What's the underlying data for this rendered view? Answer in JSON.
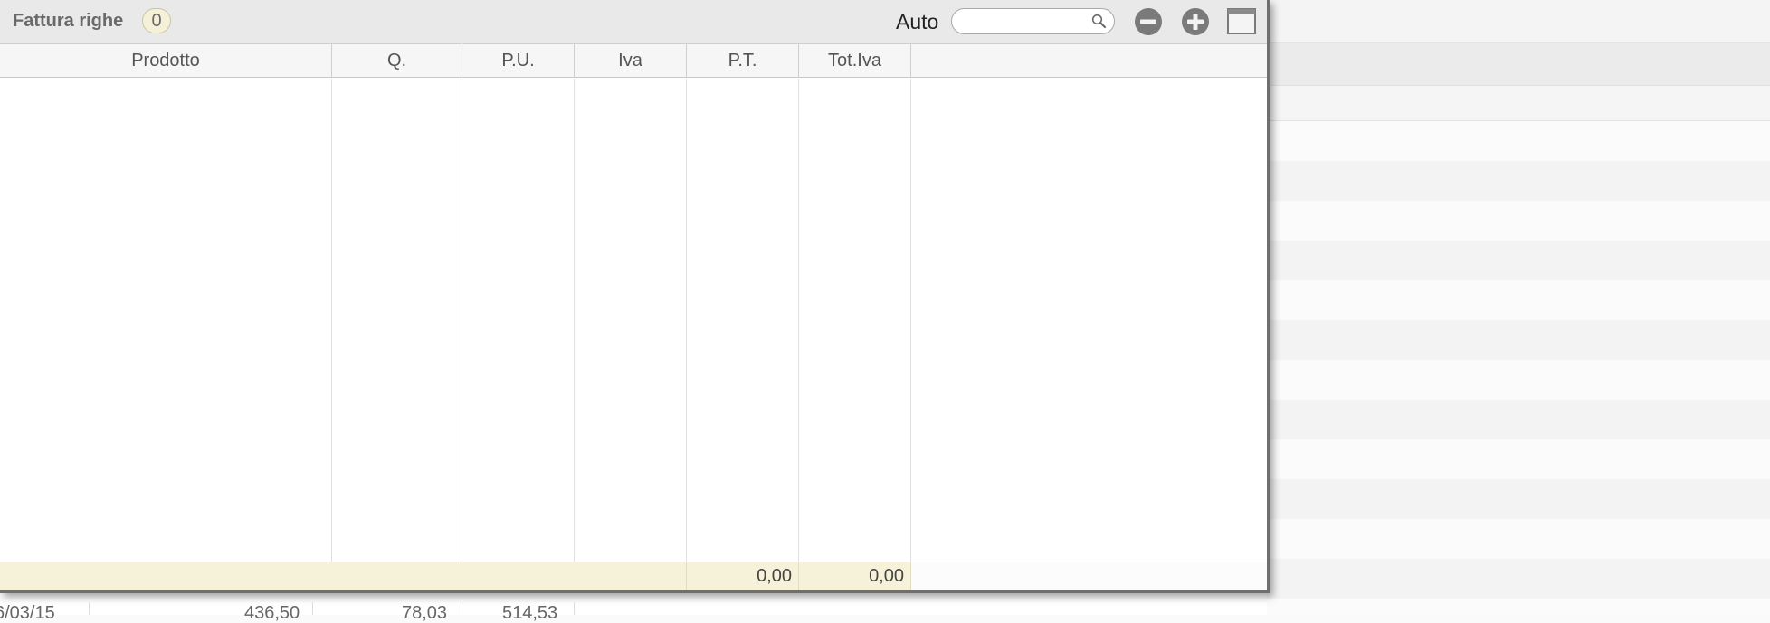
{
  "panel": {
    "title": "Fattura righe",
    "count": "0",
    "search_label": "Auto",
    "search_value": "",
    "icons": {
      "search": "magnifier-icon",
      "remove": "minus-circle-icon",
      "add": "plus-circle-icon",
      "window": "window-icon"
    }
  },
  "table": {
    "columns": [
      {
        "label": "Prodotto"
      },
      {
        "label": "Q."
      },
      {
        "label": "P.U."
      },
      {
        "label": "Iva"
      },
      {
        "label": "P.T."
      },
      {
        "label": "Tot.Iva"
      }
    ],
    "rows": [],
    "footer": {
      "pt_total": "0,00",
      "iva_total": "0,00"
    }
  },
  "background_row": {
    "date": "6/03/15",
    "value1": "436,50",
    "value2": "78,03",
    "value3": "514,53"
  },
  "colors": {
    "footer_bg": "#f6f1d9",
    "badge_bg": "#f5f1d8",
    "toolbar_bg": "#e9e9e9"
  }
}
